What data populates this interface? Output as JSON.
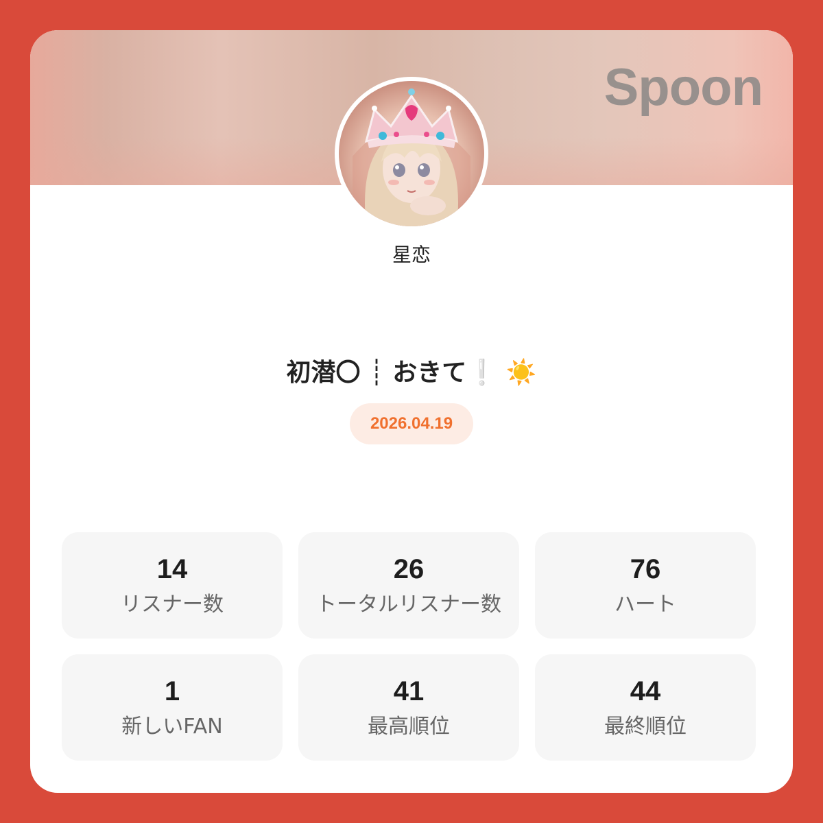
{
  "brand": {
    "logo_text": "Spoon"
  },
  "profile": {
    "username": "星恋",
    "avatar_description": "anime-girl-with-crown-avatar"
  },
  "live": {
    "title": "初潜〇 ┊ おきて❕ ☀️",
    "date": "2026.04.19"
  },
  "stats": [
    {
      "value": "14",
      "label": "リスナー数"
    },
    {
      "value": "26",
      "label": "トータルリスナー数"
    },
    {
      "value": "76",
      "label": "ハート"
    },
    {
      "value": "1",
      "label": "新しいFAN"
    },
    {
      "value": "41",
      "label": "最高順位"
    },
    {
      "value": "44",
      "label": "最終順位"
    }
  ],
  "colors": {
    "frame": "#d94a3a",
    "accent_orange": "#f0702e",
    "date_pill_bg": "#fdece4",
    "stat_card_bg": "#f6f6f6"
  }
}
